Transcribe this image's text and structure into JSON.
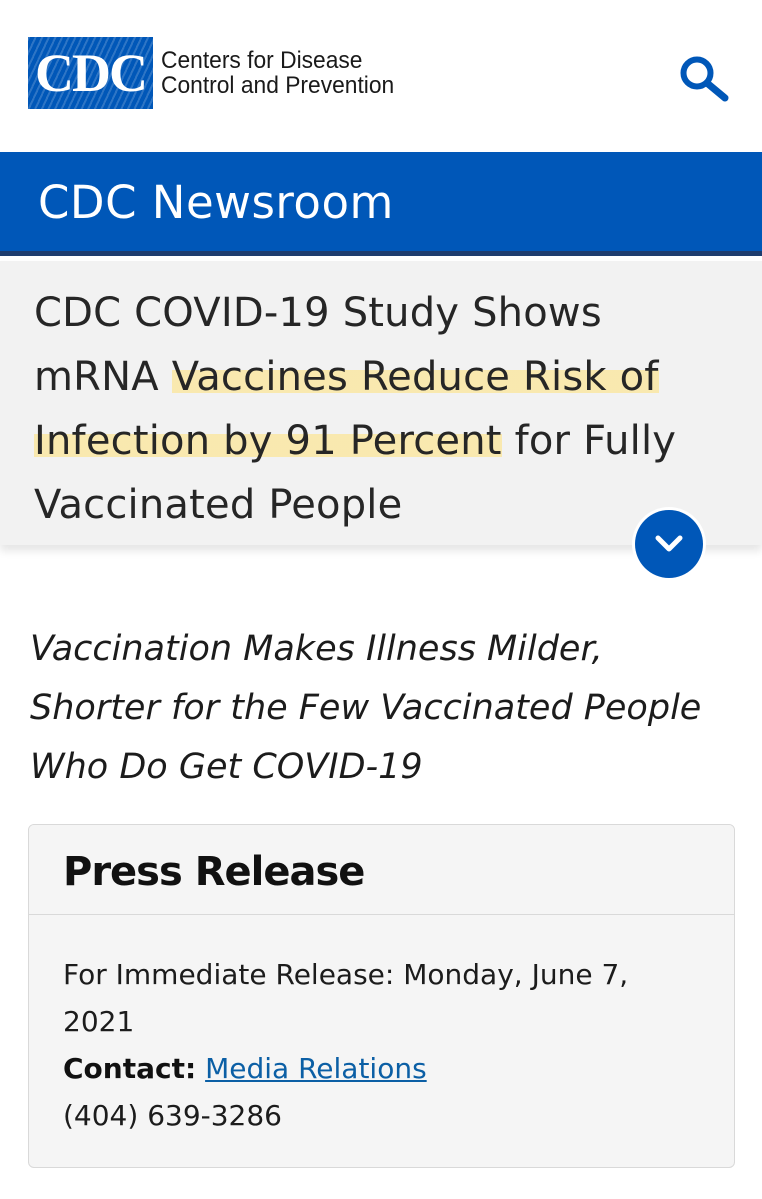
{
  "header": {
    "logo_letters": "CDC",
    "logo_line1": "Centers for Disease",
    "logo_line2": "Control and Prevention",
    "search_icon": "search-icon"
  },
  "newsroom": {
    "title": "CDC Newsroom"
  },
  "headline": {
    "part1": "CDC COVID-19 Study Shows mRNA ",
    "highlighted": "Vaccines Reduce Risk of Infection by 91 Percent",
    "part2": " for Fully Vaccinated People",
    "expand_icon": "chevron-down-icon"
  },
  "deck": {
    "text": "Vaccination Makes Illness Milder, Shorter for the Few Vaccinated People Who Do Get COVID-19"
  },
  "press_release": {
    "title": "Press Release",
    "release_line": "For Immediate Release: Monday, June 7, 2021",
    "contact_label": "Contact:",
    "contact_link": "Media Relations",
    "phone": "(404) 639-3286"
  },
  "colors": {
    "brand_blue": "#0057b8",
    "bar_border": "#1d3c6e",
    "highlight": "#ffe178",
    "link": "#0b5fa5"
  }
}
